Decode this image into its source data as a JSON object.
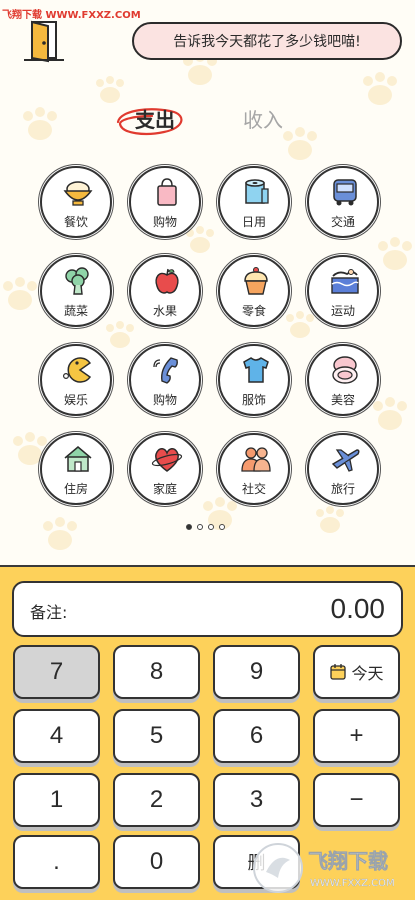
{
  "watermark_top": "飞翔下载 WWW.FXXZ.COM",
  "header": {
    "exit_icon": "door-icon",
    "bubble_text": "告诉我今天都花了多少钱吧喵!"
  },
  "tabs": [
    {
      "label": "支出",
      "active": true
    },
    {
      "label": "收入",
      "active": false
    }
  ],
  "categories": [
    {
      "label": "餐饮",
      "icon": "rice-bowl-icon"
    },
    {
      "label": "购物",
      "icon": "shopping-bag-icon"
    },
    {
      "label": "日用",
      "icon": "paper-roll-icon"
    },
    {
      "label": "交通",
      "icon": "bus-icon"
    },
    {
      "label": "蔬菜",
      "icon": "broccoli-icon"
    },
    {
      "label": "水果",
      "icon": "apple-icon"
    },
    {
      "label": "零食",
      "icon": "cupcake-icon"
    },
    {
      "label": "运动",
      "icon": "swimming-icon"
    },
    {
      "label": "娱乐",
      "icon": "pacman-icon"
    },
    {
      "label": "购物",
      "icon": "phone-icon"
    },
    {
      "label": "服饰",
      "icon": "tshirt-icon"
    },
    {
      "label": "美容",
      "icon": "compact-icon"
    },
    {
      "label": "住房",
      "icon": "house-icon"
    },
    {
      "label": "家庭",
      "icon": "heart-icon"
    },
    {
      "label": "社交",
      "icon": "people-icon"
    },
    {
      "label": "旅行",
      "icon": "airplane-icon"
    }
  ],
  "pager": {
    "count": 4,
    "active": 0
  },
  "note": {
    "label": "备注:",
    "amount": "0.00"
  },
  "keys": {
    "k7": "7",
    "k8": "8",
    "k9": "9",
    "today": "今天",
    "k4": "4",
    "k5": "5",
    "k6": "6",
    "plus": "+",
    "k1": "1",
    "k2": "2",
    "k3": "3",
    "minus": "−",
    "dot": ".",
    "k0": "0",
    "delete": "删"
  },
  "watermark_bottom": {
    "text": "飞翔下载",
    "url": "WWW.FXXZ.COM"
  },
  "colors": {
    "keypad_bg": "#fdd15a",
    "bubble_bg": "#fbe3e1",
    "accent_red": "#e03a2f"
  }
}
